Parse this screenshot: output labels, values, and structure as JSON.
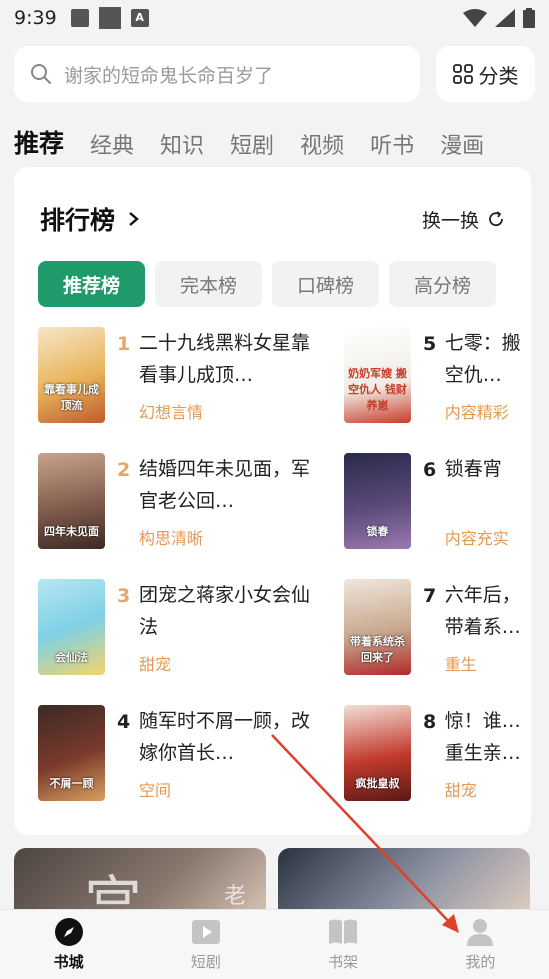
{
  "status": {
    "time": "9:39"
  },
  "search": {
    "placeholder": "谢家的短命鬼长命百岁了",
    "category_label": "分类"
  },
  "tabs": [
    "推荐",
    "经典",
    "知识",
    "短剧",
    "视频",
    "听书",
    "漫画"
  ],
  "ranking": {
    "title": "排行榜",
    "swap_label": "换一换",
    "tabs": [
      "推荐榜",
      "完本榜",
      "口碑榜",
      "高分榜"
    ],
    "items": [
      {
        "rank": "1",
        "title": "二十九线黑料女星靠看事儿成顶…",
        "tag": "幻想言情",
        "cover_text": "靠看事儿成顶流"
      },
      {
        "rank": "2",
        "title": "结婚四年未见面，军官老公回…",
        "tag": "构思清晰",
        "cover_text": "四年未见面"
      },
      {
        "rank": "3",
        "title": "团宠之蒋家小女会仙法",
        "tag": "甜宠",
        "cover_text": "会仙法"
      },
      {
        "rank": "4",
        "title": "随军时不屑一顾，改嫁你首长…",
        "tag": "空间",
        "cover_text": "不屑一顾"
      },
      {
        "rank": "5",
        "title": "七零：搬空仇…",
        "tag": "内容精彩",
        "cover_text": "奶奶军嫂 搬空仇人 钱财养崽"
      },
      {
        "rank": "6",
        "title": "锁春宵",
        "tag": "内容充实",
        "cover_text": "锁春"
      },
      {
        "rank": "7",
        "title": "六年后，带着系…",
        "tag": "重生",
        "cover_text": "带着系统杀回来了"
      },
      {
        "rank": "8",
        "title": "惊！谁…重生亲…",
        "tag": "甜宠",
        "cover_text": "疯批皇叔"
      }
    ]
  },
  "banners": [
    {
      "glyph": "宫",
      "glyph2": "老"
    },
    {
      "glyph": ""
    }
  ],
  "bottom_nav": [
    {
      "label": "书城",
      "icon": "compass-icon",
      "active": true
    },
    {
      "label": "短剧",
      "icon": "play-icon",
      "active": false
    },
    {
      "label": "书架",
      "icon": "book-icon",
      "active": false
    },
    {
      "label": "我的",
      "icon": "person-icon",
      "active": false
    }
  ],
  "colors": {
    "accent": "#1e9a6b",
    "tag": "#e39a55",
    "rank_top": "#e8a56a",
    "annotation": "#e0402a"
  }
}
